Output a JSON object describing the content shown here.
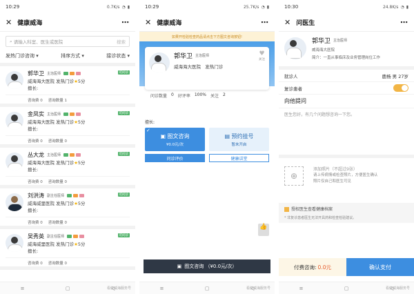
{
  "panels": [
    {
      "time": "10:29",
      "net": "0.7K/s",
      "title": "健康威海"
    },
    {
      "time": "10:29",
      "net": "25.7K/s",
      "title": "健康威海"
    },
    {
      "time": "10:30",
      "net": "24.8K/s",
      "title": "问医生"
    }
  ],
  "list": {
    "search_placeholder": "请输入科室、医生或医院",
    "search_button": "搜索",
    "filters": [
      "发热门诊咨询",
      "排序方式",
      "接诊状态"
    ],
    "doctors": [
      {
        "name": "郭华卫",
        "title": "主治医师",
        "hospital": "威海海大医院",
        "dept": "发热门诊",
        "score": "5分",
        "intro": "擅长:",
        "fee": "咨询费 0",
        "count": "咨询数量 1"
      },
      {
        "name": "金凤实",
        "title": "主治医师",
        "hospital": "威海海大医院",
        "dept": "发热门诊",
        "score": "5分",
        "intro": "擅长:",
        "fee": "咨询费 0",
        "count": "咨询数量 0"
      },
      {
        "name": "丛大龙",
        "title": "主治医师",
        "hospital": "威海海大医院",
        "dept": "发热门诊",
        "score": "5分",
        "intro": "擅长:",
        "fee": "咨询费 0",
        "count": "咨询数量 0"
      },
      {
        "name": "刘洪涛",
        "title": "副主任医师",
        "hospital": "威海威里医院",
        "dept": "发热门诊",
        "score": "5分",
        "intro": "擅长:",
        "fee": "咨询费 0",
        "count": "咨询数量 0"
      },
      {
        "name": "吴秀英",
        "title": "副主任医师",
        "hospital": "威海威里医院",
        "dept": "发热门诊",
        "score": "5分",
        "intro": "擅长:",
        "fee": "咨询费 0",
        "count": "咨询数量 0"
      }
    ],
    "online": "可问诊"
  },
  "detail": {
    "notice": "如果开检验检查药品请点击下方图文咨询按钮!",
    "name": "郭华卫",
    "title": "主治医师",
    "hospital": "威海海大医院",
    "dept": "发热门诊",
    "follow": "关注",
    "stats": {
      "consult_label": "问诊数量",
      "consult": "0",
      "rate_label": "好评率",
      "rate": "100%",
      "follow_label": "关注",
      "follow": "2"
    },
    "intro": "擅长:",
    "svc1_name": "图文咨询",
    "svc1_price": "¥0.0元/次",
    "svc2_name": "预约挂号",
    "svc2_status": "暂未开启",
    "tab1": "问诊评价",
    "tab2": "健康讲堂",
    "bottom": "图文咨询 （¥0.0元/次）"
  },
  "ask": {
    "name": "郭华卫",
    "title": "主治医师",
    "hospital": "威海海大医院",
    "intro": "简介：一直从事临床及业务管理岗位工作",
    "patient_label": "就诊人",
    "patient": "鹿杨 男 27岁",
    "revisit_label": "复诊患者",
    "question_label": "向他提问",
    "question_placeholder": "医生您好，有几个问题想咨询一下您。",
    "photo_title": "添加照片（不超过9张）",
    "photo_desc": "请上传病情或检查照片，方便医生确认",
    "photo_desc2": "照片仅自己和医生可见",
    "auth": "授权医生查看健康档案",
    "auth_note": "* 非复诊患者医生无法开具药和检查检验建议。",
    "pay_label": "付费咨询:",
    "pay_amount": "0.0元",
    "pay_button": "确认支付"
  },
  "nav": {
    "wm": "看健威海服务号"
  }
}
